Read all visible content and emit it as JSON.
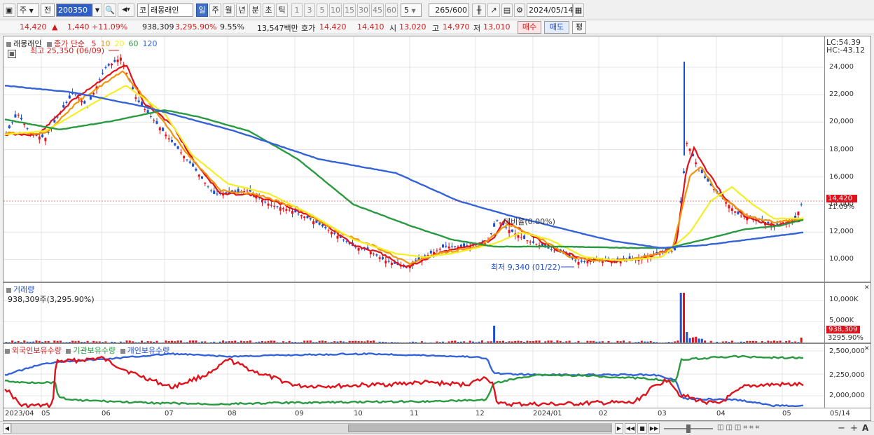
{
  "toolbar": {
    "period_primary": "주",
    "period_dropdown": "전",
    "stock_code": "200350",
    "market": "코",
    "stock_name": "래몽래인",
    "period_tabs": [
      "일",
      "주",
      "월",
      "년",
      "분",
      "초",
      "틱"
    ],
    "selected_period": "일",
    "intervals": [
      "1",
      "3",
      "5",
      "10",
      "15",
      "30",
      "45",
      "60"
    ],
    "interval_value": "5",
    "count_value": "265",
    "count_max": "/600",
    "date": "2024/05/14"
  },
  "info": {
    "price": "14,420",
    "change_arrow": "▲",
    "change": "1,440",
    "change_pct": "+11.09%",
    "volume": "938,309",
    "volume_pct": "3,295.90%",
    "turnover": "9.55%",
    "amount": "13,547백만",
    "quote_label": "호가",
    "ask": "14,420",
    "bid": "14,410",
    "open_label": "시",
    "open": "13,020",
    "high_label": "고",
    "high": "14,970",
    "low_label": "저",
    "low": "13,010",
    "buy_label": "매수",
    "sell_label": "매도",
    "avg_label": "평"
  },
  "price_panel": {
    "legend_name": "래몽래인",
    "legend_ma_prefix": "종가 단순",
    "ma_periods": [
      "5",
      "10",
      "20",
      "60",
      "120"
    ],
    "ma_colors": [
      "#e0121b",
      "#f2940b",
      "#f4ee23",
      "#2a9a41",
      "#3463d8"
    ],
    "high_annotation": "최고 25,350 (06/09)",
    "low_annotation": "최저 9,340 (01/22)",
    "mid_annotation": "대비율(0.00%)",
    "lc_label": "LC:54.39",
    "hc_label": "HC:-43.12",
    "y_ticks": [
      "24,000",
      "22,000",
      "20,000",
      "18,000",
      "16,000",
      "14,000",
      "12,000",
      "10,000"
    ],
    "current_price_tag": "14,420",
    "current_pct_tag": "11.09%"
  },
  "volume_panel": {
    "title": "거래량",
    "value_text": "938,309주(3,295.90%)",
    "y_ticks": [
      "10,000K",
      "5,000K"
    ],
    "current_tag": "938,309",
    "current_pct_tag": "3295.90%"
  },
  "holdings_panel": {
    "series": [
      "외국인보유수량",
      "기관보유수량",
      "개인보유수량"
    ],
    "colors": [
      "#e0121b",
      "#2a9a41",
      "#3463d8"
    ],
    "y_ticks": [
      "2,500,000",
      "2,250,000",
      "2,000,000"
    ]
  },
  "x_axis": {
    "labels": [
      "2023/04",
      "05",
      "06",
      "07",
      "08",
      "09",
      "10",
      "11",
      "12",
      "2024/01",
      "02",
      "03",
      "04",
      "05",
      "05/14"
    ]
  }
}
